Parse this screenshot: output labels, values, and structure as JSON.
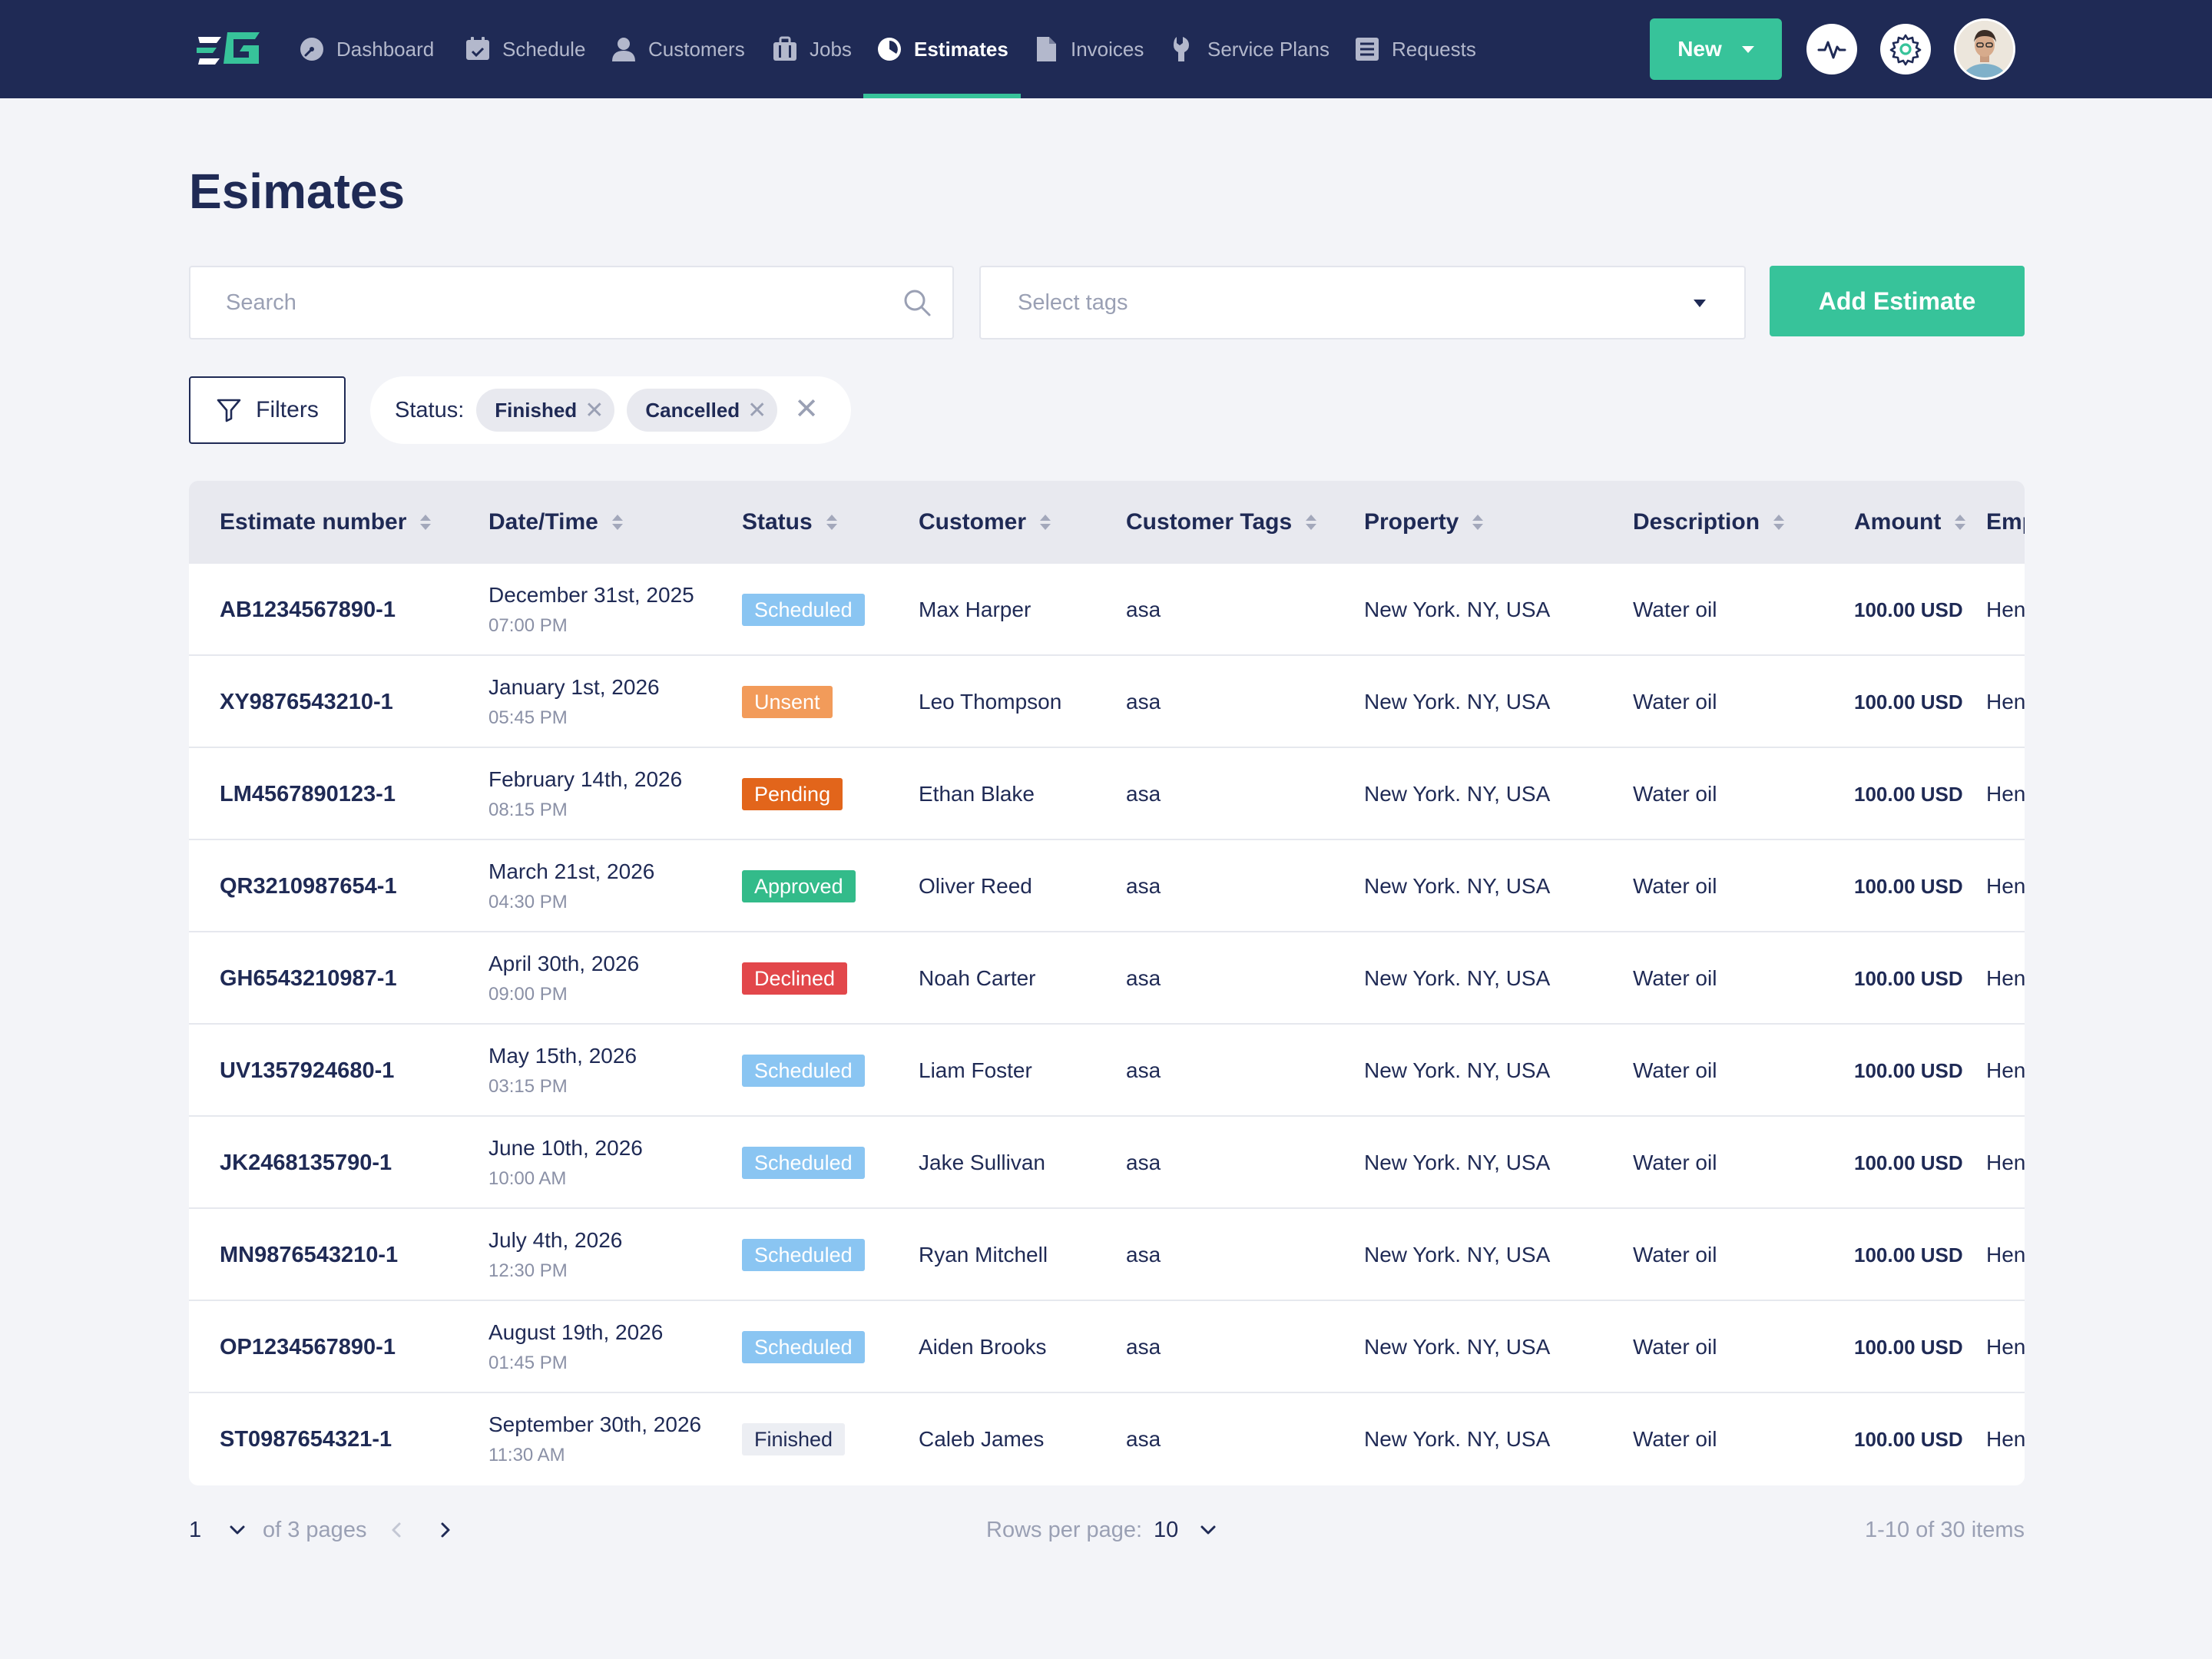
{
  "nav": {
    "items": [
      {
        "label": "Dashboard",
        "icon": "dashboard-icon"
      },
      {
        "label": "Schedule",
        "icon": "calendar-icon"
      },
      {
        "label": "Customers",
        "icon": "user-icon"
      },
      {
        "label": "Jobs",
        "icon": "briefcase-icon"
      },
      {
        "label": "Estimates",
        "icon": "pie-chart-icon",
        "active": true
      },
      {
        "label": "Invoices",
        "icon": "document-icon"
      },
      {
        "label": "Service Plans",
        "icon": "wrench-icon"
      },
      {
        "label": "Requests",
        "icon": "list-icon"
      }
    ],
    "new_label": "New"
  },
  "page": {
    "title": "Esimates",
    "search_placeholder": "Search",
    "tags_placeholder": "Select tags",
    "add_label": "Add Estimate",
    "filters_label": "Filters",
    "status_label": "Status:",
    "status_chips": [
      "Finished",
      "Cancelled"
    ]
  },
  "table": {
    "columns": [
      "Estimate number",
      "Date/Time",
      "Status",
      "Customer",
      "Customer Tags",
      "Property",
      "Description",
      "Amount",
      "Emp"
    ],
    "rows": [
      {
        "number": "AB1234567890-1",
        "date": "December 31st, 2025",
        "time": "07:00 PM",
        "status": "Scheduled",
        "customer": "Max Harper",
        "tags": "asa",
        "property": "New York. NY, USA",
        "description": "Water oil",
        "amount": "100.00 USD",
        "emp": "Hen"
      },
      {
        "number": "XY9876543210-1",
        "date": "January 1st, 2026",
        "time": "05:45 PM",
        "status": "Unsent",
        "customer": "Leo Thompson",
        "tags": "asa",
        "property": "New York. NY, USA",
        "description": "Water oil",
        "amount": "100.00 USD",
        "emp": "Hen"
      },
      {
        "number": "LM4567890123-1",
        "date": "February 14th, 2026",
        "time": "08:15 PM",
        "status": "Pending",
        "customer": "Ethan Blake",
        "tags": "asa",
        "property": "New York. NY, USA",
        "description": "Water oil",
        "amount": "100.00 USD",
        "emp": "Hen"
      },
      {
        "number": "QR3210987654-1",
        "date": "March 21st, 2026",
        "time": "04:30 PM",
        "status": "Approved",
        "customer": "Oliver Reed",
        "tags": "asa",
        "property": "New York. NY, USA",
        "description": "Water oil",
        "amount": "100.00 USD",
        "emp": "Hen"
      },
      {
        "number": "GH6543210987-1",
        "date": "April 30th, 2026",
        "time": "09:00 PM",
        "status": "Declined",
        "customer": "Noah Carter",
        "tags": "asa",
        "property": "New York. NY, USA",
        "description": "Water oil",
        "amount": "100.00 USD",
        "emp": "Hen"
      },
      {
        "number": "UV1357924680-1",
        "date": "May 15th, 2026",
        "time": "03:15 PM",
        "status": "Scheduled",
        "customer": "Liam Foster",
        "tags": "asa",
        "property": "New York. NY, USA",
        "description": "Water oil",
        "amount": "100.00 USD",
        "emp": "Hen"
      },
      {
        "number": "JK2468135790-1",
        "date": "June 10th, 2026",
        "time": "10:00 AM",
        "status": "Scheduled",
        "customer": "Jake Sullivan",
        "tags": "asa",
        "property": "New York. NY, USA",
        "description": "Water oil",
        "amount": "100.00 USD",
        "emp": "Hen"
      },
      {
        "number": "MN9876543210-1",
        "date": "July 4th, 2026",
        "time": "12:30 PM",
        "status": "Scheduled",
        "customer": "Ryan Mitchell",
        "tags": "asa",
        "property": "New York. NY, USA",
        "description": "Water oil",
        "amount": "100.00 USD",
        "emp": "Hen"
      },
      {
        "number": "OP1234567890-1",
        "date": "August 19th, 2026",
        "time": "01:45 PM",
        "status": "Scheduled",
        "customer": "Aiden Brooks",
        "tags": "asa",
        "property": "New York. NY, USA",
        "description": "Water oil",
        "amount": "100.00 USD",
        "emp": "Hen"
      },
      {
        "number": "ST0987654321-1",
        "date": "September 30th, 2026",
        "time": "11:30 AM",
        "status": "Finished",
        "customer": "Caleb James",
        "tags": "asa",
        "property": "New York. NY, USA",
        "description": "Water oil",
        "amount": "100.00 USD",
        "emp": "Hen"
      }
    ]
  },
  "pagination": {
    "current_page": "1",
    "of_pages": "of 3 pages",
    "rows_per_page_label": "Rows per page:",
    "rows_per_page": "10",
    "items_summary": "1-10 of 30 items"
  },
  "colors": {
    "nav_bg": "#1f2a55",
    "accent": "#37c39a",
    "page_bg": "#f3f4f8",
    "status": {
      "Scheduled": "#8ac5f2",
      "Unsent": "#f29b5a",
      "Pending": "#e2651b",
      "Approved": "#33bb8a",
      "Declined": "#e2474b",
      "Finished": "#eceef3"
    }
  }
}
